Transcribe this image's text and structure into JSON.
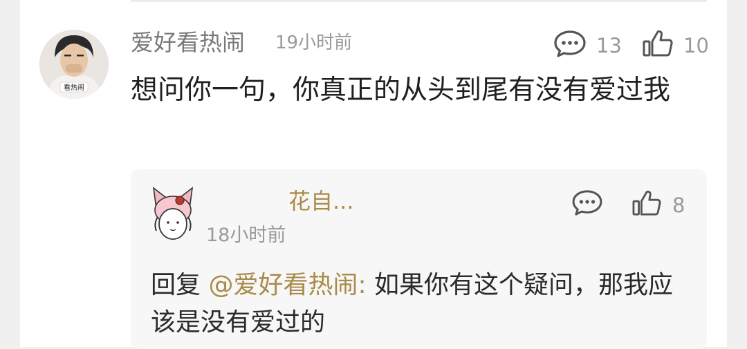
{
  "comment": {
    "username": "爱好看热闹",
    "time": "19小时前",
    "avatar_text": "看热闹",
    "text": "想问你一句，你真正的从头到尾有没有爱过我",
    "reply_count": "13",
    "like_count": "10"
  },
  "reply": {
    "username": "花自...",
    "time": "18小时前",
    "prefix": "回复 ",
    "mention": "@爱好看热闹:",
    "text": " 如果你有这个疑问，那我应该是没有爱过的",
    "reply_icon": "comment-icon",
    "like_count": "8"
  },
  "colors": {
    "accent_gold": "#a98b4a",
    "icon_gray": "#555555",
    "text_gray": "#9a9a9a"
  }
}
